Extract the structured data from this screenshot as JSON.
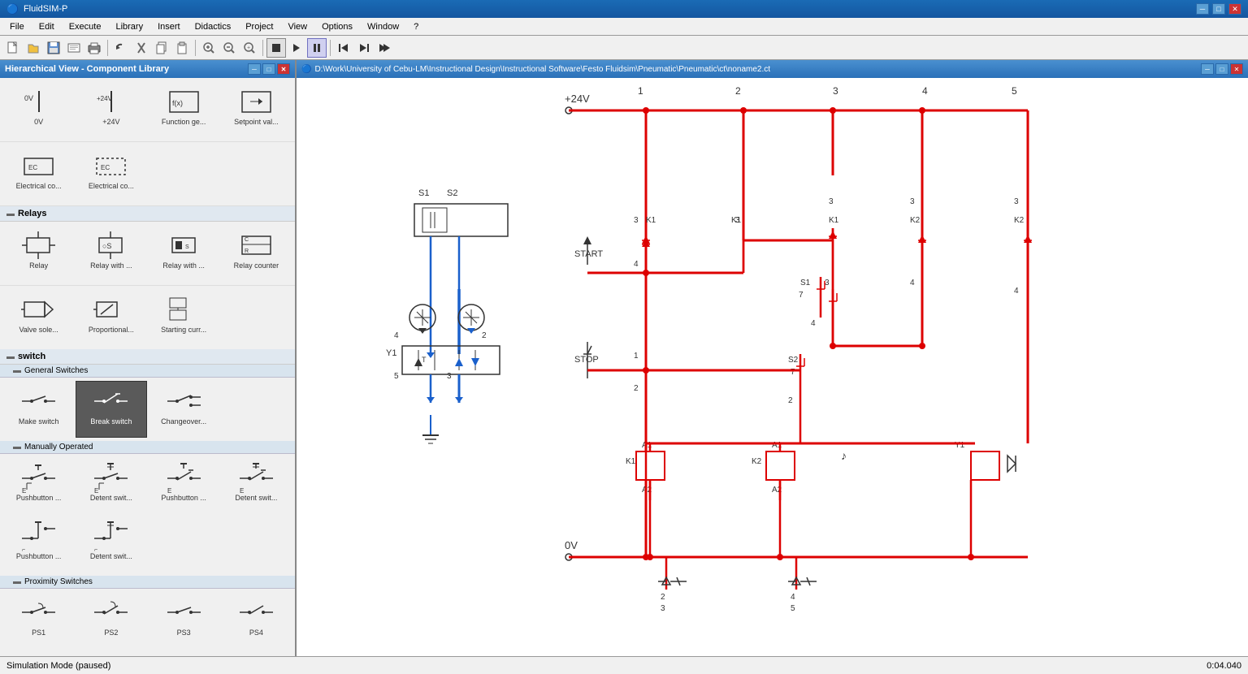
{
  "app": {
    "title": "FluidSIM-P",
    "window_controls": [
      "─",
      "□",
      "✕"
    ]
  },
  "menu": {
    "items": [
      "File",
      "Edit",
      "Execute",
      "Library",
      "Insert",
      "Didactics",
      "Project",
      "View",
      "Options",
      "Window",
      "?"
    ]
  },
  "toolbar": {
    "buttons": [
      {
        "name": "new",
        "icon": "📄"
      },
      {
        "name": "open",
        "icon": "📂"
      },
      {
        "name": "save",
        "icon": "💾"
      },
      {
        "name": "print-preview",
        "icon": "🖨"
      },
      {
        "name": "print",
        "icon": "🖨"
      },
      {
        "name": "undo",
        "icon": "↩"
      },
      {
        "name": "cut",
        "icon": "✂"
      },
      {
        "name": "copy",
        "icon": "📋"
      },
      {
        "name": "paste",
        "icon": "📋"
      },
      {
        "name": "zoom-in",
        "icon": "🔍"
      },
      {
        "name": "zoom-out",
        "icon": "🔍"
      },
      {
        "name": "stop",
        "icon": "■"
      },
      {
        "name": "play",
        "icon": "▶"
      },
      {
        "name": "pause",
        "icon": "⏸"
      },
      {
        "name": "step-back",
        "icon": "⏮"
      },
      {
        "name": "step-fwd",
        "icon": "⏭"
      },
      {
        "name": "end",
        "icon": "⏭"
      }
    ]
  },
  "library": {
    "title": "Hierarchical View - Component Library",
    "sections": [
      {
        "name": "Relays",
        "items": [
          {
            "label": "Relay",
            "id": "relay"
          },
          {
            "label": "Relay with ...",
            "id": "relay-with-1"
          },
          {
            "label": "Relay with ...",
            "id": "relay-with-2"
          },
          {
            "label": "Relay counter",
            "id": "relay-counter"
          }
        ]
      },
      {
        "name": "switch",
        "subsections": [
          {
            "name": "General Switches",
            "items": [
              {
                "label": "Make switch",
                "id": "make-switch"
              },
              {
                "label": "Break switch",
                "id": "break-switch",
                "selected": true
              },
              {
                "label": "Changeover...",
                "id": "changeover"
              }
            ]
          },
          {
            "name": "Manually Operated",
            "items": [
              {
                "label": "Pushbutton ...",
                "id": "pushbutton-1"
              },
              {
                "label": "Detent swit...",
                "id": "detent-switch-1"
              },
              {
                "label": "Pushbutton ...",
                "id": "pushbutton-2"
              },
              {
                "label": "Detent swit...",
                "id": "detent-switch-2"
              },
              {
                "label": "Pushbutton ...",
                "id": "pushbutton-3"
              },
              {
                "label": "Detent swit...",
                "id": "detent-switch-3"
              }
            ]
          },
          {
            "name": "Proximity Switches",
            "items": [
              {
                "label": "PS1",
                "id": "ps1"
              },
              {
                "label": "PS2",
                "id": "ps2"
              },
              {
                "label": "PS3",
                "id": "ps3"
              },
              {
                "label": "PS4",
                "id": "ps4"
              }
            ]
          }
        ]
      }
    ]
  },
  "diagram": {
    "title_bar": "D:\\Work\\University of Cebu-LM\\Instructional Design\\Instructional Software\\Festo Fluidsim\\Pneumatic\\Pneumatic\\ct\\noname2.ct",
    "voltage_pos": "+24V",
    "voltage_neg": "0V",
    "labels": {
      "start": "START",
      "stop": "STOP",
      "columns": [
        "1",
        "2",
        "3",
        "4",
        "5"
      ]
    }
  },
  "status_bar": {
    "mode": "Simulation Mode (paused)",
    "time": "0:04.040"
  },
  "electrical_items": [
    {
      "label": "Electrical co...",
      "id": "ec1"
    },
    {
      "label": "Electrical co...",
      "id": "ec2"
    },
    {
      "label": "Function ge...",
      "id": "fg"
    },
    {
      "label": "Setpoint val...",
      "id": "sv"
    }
  ],
  "valve_items": [
    {
      "label": "Valve sole...",
      "id": "vs"
    },
    {
      "label": "Proportional...",
      "id": "prop"
    },
    {
      "label": "Starting curr...",
      "id": "sc"
    }
  ]
}
